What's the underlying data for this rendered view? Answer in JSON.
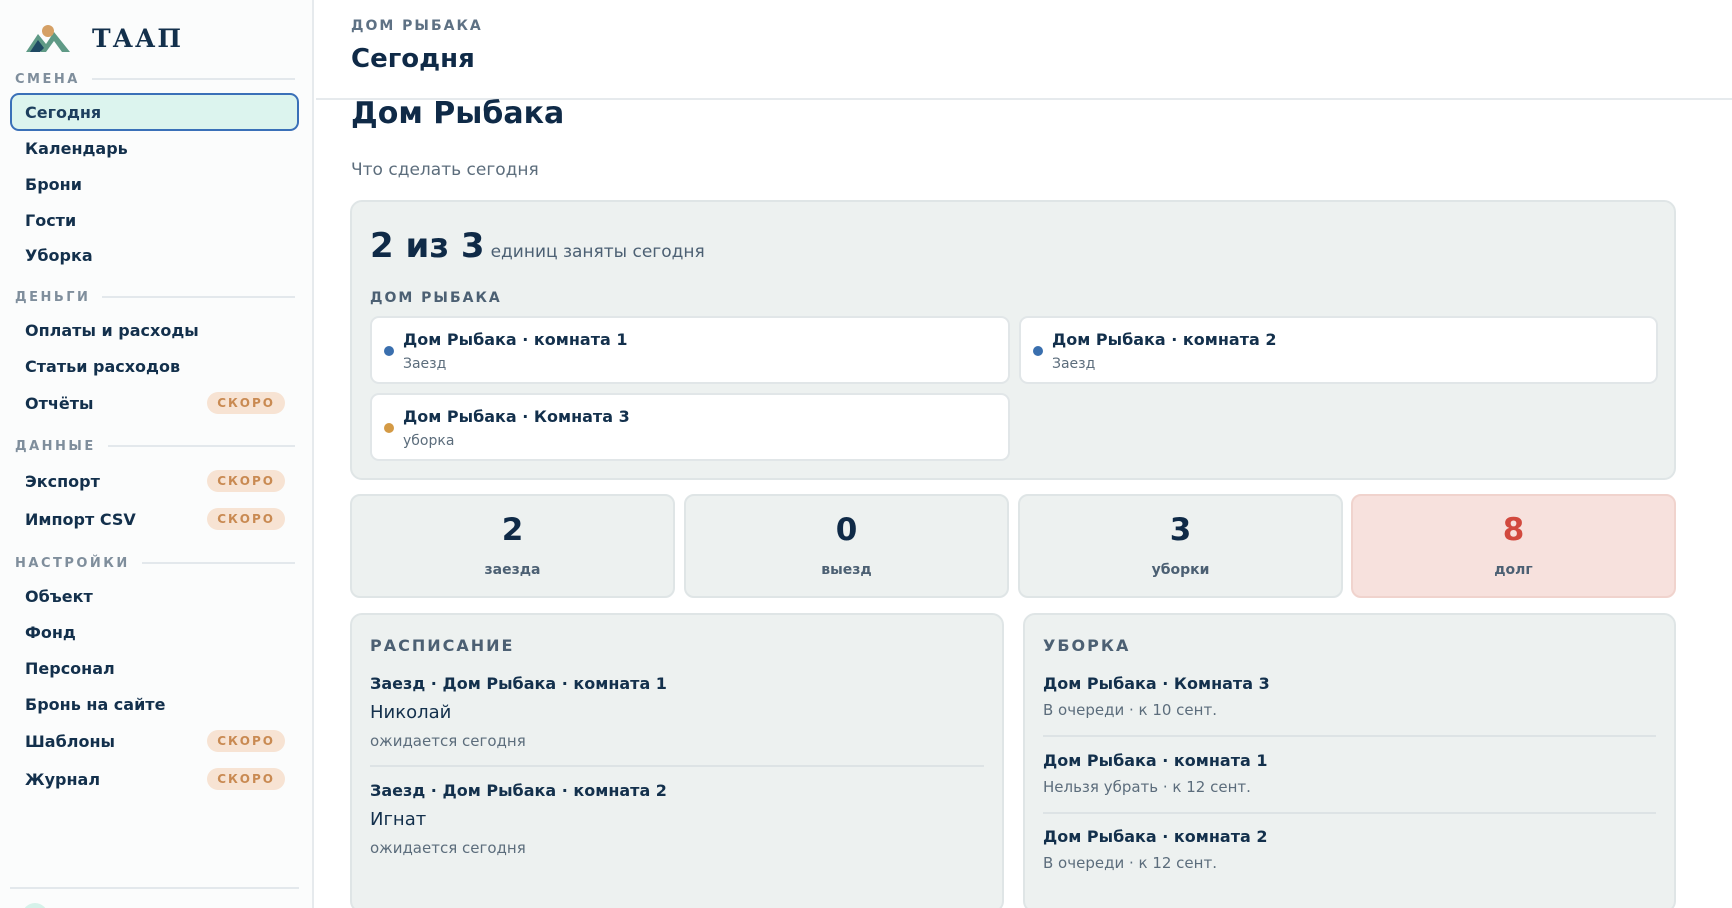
{
  "brand": {
    "name": "ТААП",
    "logo_icon": "mountains-sun-logo"
  },
  "sidebar": {
    "sections": {
      "shift": "СМЕНА",
      "money": "ДЕНЬГИ",
      "data": "ДАННЫЕ",
      "settings": "НАСТРОЙКИ"
    },
    "items": {
      "today": {
        "label": "Сегодня",
        "active": true
      },
      "calendar": {
        "label": "Календарь"
      },
      "bookings": {
        "label": "Брони"
      },
      "guests": {
        "label": "Гости"
      },
      "cleaning": {
        "label": "Уборка"
      },
      "payments": {
        "label": "Оплаты и расходы"
      },
      "expense_items": {
        "label": "Статьи расходов"
      },
      "reports": {
        "label": "Отчёты",
        "badge": "СКОРО"
      },
      "export": {
        "label": "Экспорт",
        "badge": "СКОРО"
      },
      "import_csv": {
        "label": "Импорт CSV",
        "badge": "СКОРО"
      },
      "property": {
        "label": "Объект"
      },
      "fund": {
        "label": "Фонд"
      },
      "staff": {
        "label": "Персонал"
      },
      "site_booking": {
        "label": "Бронь на сайте"
      },
      "templates": {
        "label": "Шаблоны",
        "badge": "СКОРО"
      },
      "journal": {
        "label": "Журнал",
        "badge": "СКОРО"
      }
    }
  },
  "header": {
    "breadcrumb": "ДОМ РЫБАКА",
    "title": "Сегодня"
  },
  "page": {
    "title": "Дом Рыбака",
    "subtitle": "Что сделать сегодня"
  },
  "occupancy": {
    "headline": "2 из 3",
    "caption": "единиц заняты сегодня",
    "group_label": "ДОМ РЫБАКА",
    "rooms": [
      {
        "name": "Дом Рыбака · комната 1",
        "status": "Заезд",
        "color": "#3a6fae"
      },
      {
        "name": "Дом Рыбака · комната 2",
        "status": "Заезд",
        "color": "#3a6fae"
      },
      {
        "name": "Дом Рыбака · Комната 3",
        "status": "уборка",
        "color": "#d49a45"
      }
    ]
  },
  "stats": [
    {
      "value": "2",
      "label": "заезда"
    },
    {
      "value": "0",
      "label": "выезд"
    },
    {
      "value": "3",
      "label": "уборки"
    },
    {
      "value": "8",
      "label": "долг",
      "color": "#d2493e"
    }
  ],
  "schedule": {
    "title": "РАСПИСАНИЕ",
    "entries": [
      {
        "head": "Заезд · Дом Рыбака · комната 1",
        "name": "Николай",
        "sub": "ожидается сегодня"
      },
      {
        "head": "Заезд · Дом Рыбака · комната 2",
        "name": "Игнат",
        "sub": "ожидается сегодня"
      }
    ]
  },
  "cleaning": {
    "title": "УБОРКА",
    "entries": [
      {
        "head": "Дом Рыбака · Комната 3",
        "sub": "В очереди · к 10 сент."
      },
      {
        "head": "Дом Рыбака · комната 1",
        "sub": "Нельзя убрать · к 12 сент."
      },
      {
        "head": "Дом Рыбака · комната 2",
        "sub": "В очереди · к 12 сент."
      }
    ]
  }
}
